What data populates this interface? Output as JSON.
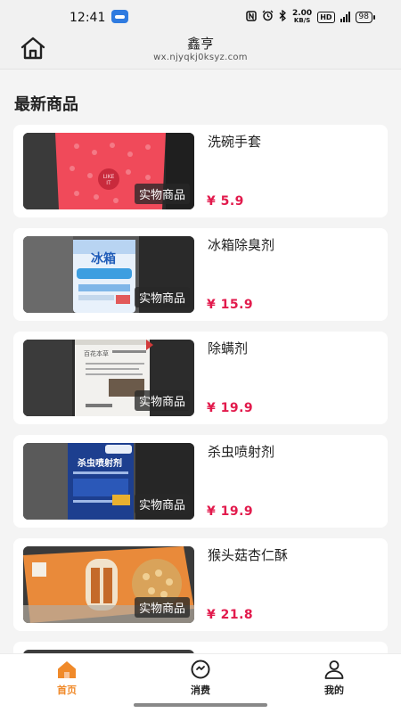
{
  "status_bar": {
    "time": "12:41",
    "net_speed_value": "2.00",
    "net_speed_unit": "KB/S",
    "hd_badge": "HD",
    "battery": "98",
    "icons": [
      "nfc-icon",
      "alarm-icon",
      "bluetooth-icon",
      "speed-indicator",
      "hd-badge",
      "signal-icon",
      "battery-icon"
    ]
  },
  "header": {
    "title": "鑫亨",
    "subtitle": "wx.njyqkj0ksyz.com",
    "home_icon": "home-outline-icon"
  },
  "section": {
    "title": "最新商品"
  },
  "products": [
    {
      "name": "洗碗手套",
      "price": "¥ 5.9",
      "badge": "实物商品",
      "image": "red-gloves"
    },
    {
      "name": "冰箱除臭剂",
      "price": "¥ 15.9",
      "badge": "实物商品",
      "image": "fridge-deodorizer"
    },
    {
      "name": "除螨剂",
      "price": "¥ 19.9",
      "badge": "实物商品",
      "image": "mite-remover-bottle"
    },
    {
      "name": "杀虫喷射剂",
      "price": "¥ 19.9",
      "badge": "实物商品",
      "image": "insecticide-spray"
    },
    {
      "name": "猴头菇杏仁酥",
      "price": "¥ 21.8",
      "badge": "实物商品",
      "image": "almond-cookies-box"
    }
  ],
  "tabs": [
    {
      "label": "首页",
      "icon": "home-icon",
      "active": true
    },
    {
      "label": "消费",
      "icon": "consume-icon",
      "active": false
    },
    {
      "label": "我的",
      "icon": "user-icon",
      "active": false
    }
  ],
  "colors": {
    "price": "#e21a4c",
    "active_tab": "#f08a2a",
    "background": "#f4f4f4"
  }
}
